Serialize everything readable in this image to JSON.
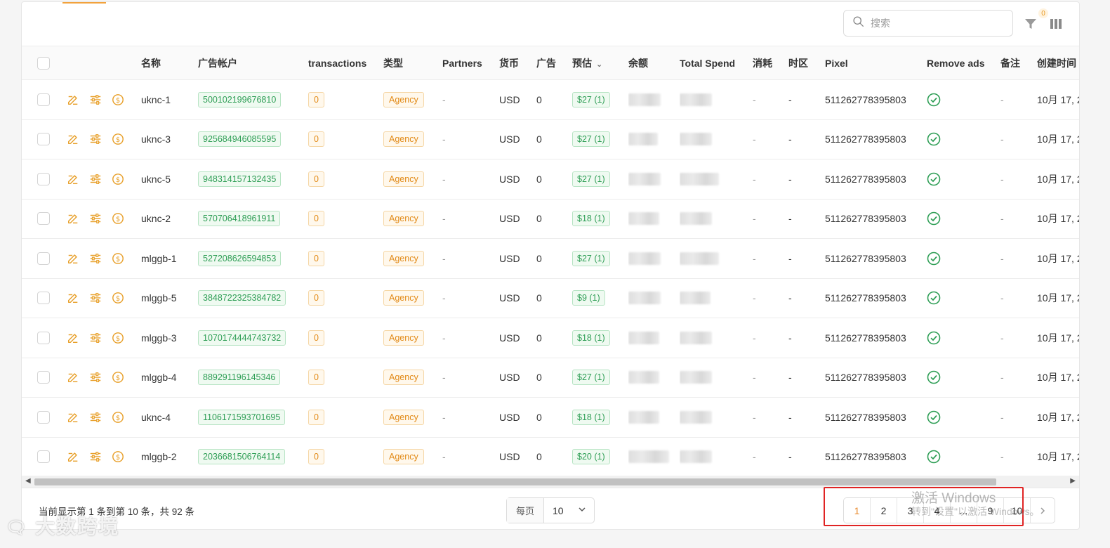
{
  "toolbar": {
    "search_placeholder": "搜索",
    "filter_badge": "0"
  },
  "columns": [
    "名称",
    "广告帐户",
    "transactions",
    "类型",
    "Partners",
    "货币",
    "广告",
    "预估",
    "余额",
    "Total Spend",
    "消耗",
    "时区",
    "Pixel",
    "Remove ads",
    "备注",
    "创建时间"
  ],
  "rows": [
    {
      "name": "uknc-1",
      "account": "500102199676810",
      "transactions": "0",
      "type": "Agency",
      "partners": "-",
      "currency": "USD",
      "ads": "0",
      "estimate": "$27 (1)",
      "consumption": "-",
      "timezone": "-",
      "pixel": "511262778395803",
      "note": "-",
      "created": "10月 17, 2"
    },
    {
      "name": "uknc-3",
      "account": "925684946085595",
      "transactions": "0",
      "type": "Agency",
      "partners": "-",
      "currency": "USD",
      "ads": "0",
      "estimate": "$27 (1)",
      "consumption": "-",
      "timezone": "-",
      "pixel": "511262778395803",
      "note": "-",
      "created": "10月 17, 2"
    },
    {
      "name": "uknc-5",
      "account": "948314157132435",
      "transactions": "0",
      "type": "Agency",
      "partners": "-",
      "currency": "USD",
      "ads": "0",
      "estimate": "$27 (1)",
      "consumption": "-",
      "timezone": "-",
      "pixel": "511262778395803",
      "note": "-",
      "created": "10月 17, 2"
    },
    {
      "name": "uknc-2",
      "account": "570706418961911",
      "transactions": "0",
      "type": "Agency",
      "partners": "-",
      "currency": "USD",
      "ads": "0",
      "estimate": "$18 (1)",
      "consumption": "-",
      "timezone": "-",
      "pixel": "511262778395803",
      "note": "-",
      "created": "10月 17, 2"
    },
    {
      "name": "mlggb-1",
      "account": "527208626594853",
      "transactions": "0",
      "type": "Agency",
      "partners": "-",
      "currency": "USD",
      "ads": "0",
      "estimate": "$27 (1)",
      "consumption": "-",
      "timezone": "-",
      "pixel": "511262778395803",
      "note": "-",
      "created": "10月 17, 2"
    },
    {
      "name": "mlggb-5",
      "account": "3848722325384782",
      "transactions": "0",
      "type": "Agency",
      "partners": "-",
      "currency": "USD",
      "ads": "0",
      "estimate": "$9 (1)",
      "consumption": "-",
      "timezone": "-",
      "pixel": "511262778395803",
      "note": "-",
      "created": "10月 17, 2"
    },
    {
      "name": "mlggb-3",
      "account": "1070174444743732",
      "transactions": "0",
      "type": "Agency",
      "partners": "-",
      "currency": "USD",
      "ads": "0",
      "estimate": "$18 (1)",
      "consumption": "-",
      "timezone": "-",
      "pixel": "511262778395803",
      "note": "-",
      "created": "10月 17, 2"
    },
    {
      "name": "mlggb-4",
      "account": "889291196145346",
      "transactions": "0",
      "type": "Agency",
      "partners": "-",
      "currency": "USD",
      "ads": "0",
      "estimate": "$27 (1)",
      "consumption": "-",
      "timezone": "-",
      "pixel": "511262778395803",
      "note": "-",
      "created": "10月 17, 2"
    },
    {
      "name": "uknc-4",
      "account": "1106171593701695",
      "transactions": "0",
      "type": "Agency",
      "partners": "-",
      "currency": "USD",
      "ads": "0",
      "estimate": "$18 (1)",
      "consumption": "-",
      "timezone": "-",
      "pixel": "511262778395803",
      "note": "-",
      "created": "10月 17, 2"
    },
    {
      "name": "mlggb-2",
      "account": "2036681506764114",
      "transactions": "0",
      "type": "Agency",
      "partners": "-",
      "currency": "USD",
      "ads": "0",
      "estimate": "$20 (1)",
      "consumption": "-",
      "timezone": "-",
      "pixel": "511262778395803",
      "note": "-",
      "created": "10月 17, 2"
    }
  ],
  "footer": {
    "range_text": "当前显示第 1 条到第 10 条，共 92 条",
    "page_size_label": "每页",
    "page_size_value": "10",
    "pages": [
      "1",
      "2",
      "3",
      "4",
      "...",
      "9",
      "10"
    ],
    "active_page": "1"
  },
  "overlay": {
    "activation_title": "激活 Windows",
    "activation_sub": "转到\"设置\"以激活 Windows。",
    "watermark": "大数跨境"
  },
  "colors": {
    "accent": "#e8892b",
    "tag_green": "#2e9e55",
    "tag_orange": "#e28a17",
    "highlight_box": "#e02424"
  }
}
